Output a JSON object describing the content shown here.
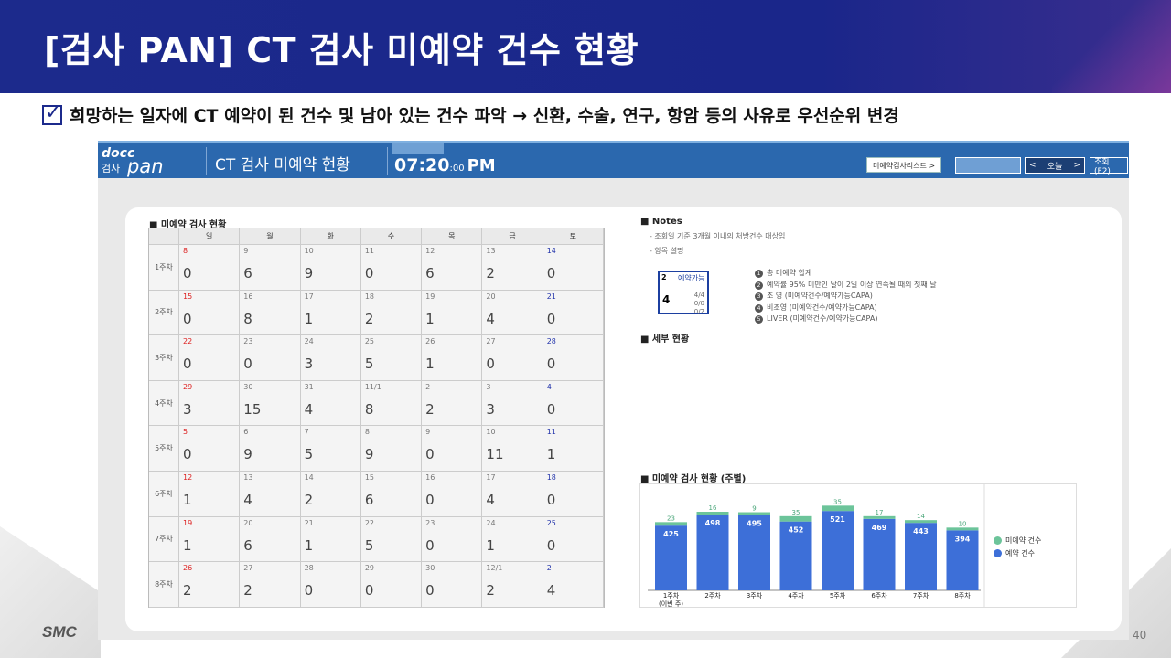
{
  "slide": {
    "title": "[검사 PAN] CT 검사 미예약 건수 현황",
    "bullet": "희망하는 일자에 CT 예약이 된 건수 및 남아 있는 건수 파악 → 신환, 수술, 연구, 항암 등의 사유로 우선순위 변경",
    "logo": "SMC",
    "page_number": "40"
  },
  "app": {
    "logo_top": "docc",
    "logo_sub": "검사",
    "logo_pan": "pan",
    "title": "CT 검사 미예약 현황",
    "clock_hm": "07:20",
    "clock_ss": ":00",
    "clock_ampm": "PM",
    "list_button": "미예약검사리스트 >",
    "prev": "<",
    "today": "오늘",
    "next": ">",
    "search_button": "조회(F2)"
  },
  "calendar": {
    "title": "■ 미예약 검사 현황",
    "days": [
      "일",
      "월",
      "화",
      "수",
      "목",
      "금",
      "토"
    ],
    "weeks": [
      {
        "label": "1주차",
        "dates": [
          "8",
          "9",
          "10",
          "11",
          "12",
          "13",
          "14"
        ],
        "values": [
          "0",
          "6",
          "9",
          "0",
          "6",
          "2",
          "0"
        ]
      },
      {
        "label": "2주차",
        "dates": [
          "15",
          "16",
          "17",
          "18",
          "19",
          "20",
          "21"
        ],
        "values": [
          "0",
          "8",
          "1",
          "2",
          "1",
          "4",
          "0"
        ]
      },
      {
        "label": "3주차",
        "dates": [
          "22",
          "23",
          "24",
          "25",
          "26",
          "27",
          "28"
        ],
        "values": [
          "0",
          "0",
          "3",
          "5",
          "1",
          "0",
          "0"
        ]
      },
      {
        "label": "4주차",
        "dates": [
          "29",
          "30",
          "31",
          "11/1",
          "2",
          "3",
          "4"
        ],
        "values": [
          "3",
          "15",
          "4",
          "8",
          "2",
          "3",
          "0"
        ]
      },
      {
        "label": "5주차",
        "dates": [
          "5",
          "6",
          "7",
          "8",
          "9",
          "10",
          "11"
        ],
        "values": [
          "0",
          "9",
          "5",
          "9",
          "0",
          "11",
          "1"
        ]
      },
      {
        "label": "6주차",
        "dates": [
          "12",
          "13",
          "14",
          "15",
          "16",
          "17",
          "18"
        ],
        "values": [
          "1",
          "4",
          "2",
          "6",
          "0",
          "4",
          "0"
        ]
      },
      {
        "label": "7주차",
        "dates": [
          "19",
          "20",
          "21",
          "22",
          "23",
          "24",
          "25"
        ],
        "values": [
          "1",
          "6",
          "1",
          "5",
          "0",
          "1",
          "0"
        ]
      },
      {
        "label": "8주차",
        "dates": [
          "26",
          "27",
          "28",
          "29",
          "30",
          "12/1",
          "2"
        ],
        "values": [
          "2",
          "2",
          "0",
          "0",
          "0",
          "2",
          "4"
        ]
      }
    ]
  },
  "notes": {
    "title": "■ Notes",
    "line1": "- 조회일 기준 3개월 이내의 처방건수 대상임",
    "line2": "- 항목 설명",
    "box_num": "2",
    "box_label": "예약가능",
    "box_big": "4",
    "box_r1": "4/4",
    "box_r2": "0/0",
    "box_r3": "0/2",
    "items": [
      "총 미예약 합계",
      "예약률 95% 미만인 날이 2일 이상 연속될 때의 첫째 날",
      "조    영 (미예약건수/예약가능CAPA)",
      "비조영 (미예약건수/예약가능CAPA)",
      "LIVER  (미예약건수/예약가능CAPA)"
    ],
    "item_marks": [
      "1",
      "2",
      "3",
      "4",
      "5"
    ]
  },
  "detail": {
    "title": "■ 세부 현황"
  },
  "chart_data": {
    "type": "bar",
    "title": "■ 미예약 검사 현황 (주별)",
    "stacked": true,
    "categories": [
      "1주차\n(이번 주)",
      "2주차",
      "3주차",
      "4주차",
      "5주차",
      "6주차",
      "7주차",
      "8주차"
    ],
    "series": [
      {
        "name": "예약 건수",
        "values": [
          425,
          498,
          495,
          452,
          521,
          469,
          443,
          394
        ],
        "color": "#3d6fd8"
      },
      {
        "name": "미예약 건수",
        "values": [
          23,
          16,
          9,
          35,
          35,
          17,
          14,
          10
        ],
        "color": "#6cc49a"
      }
    ],
    "legend_position": "right"
  }
}
